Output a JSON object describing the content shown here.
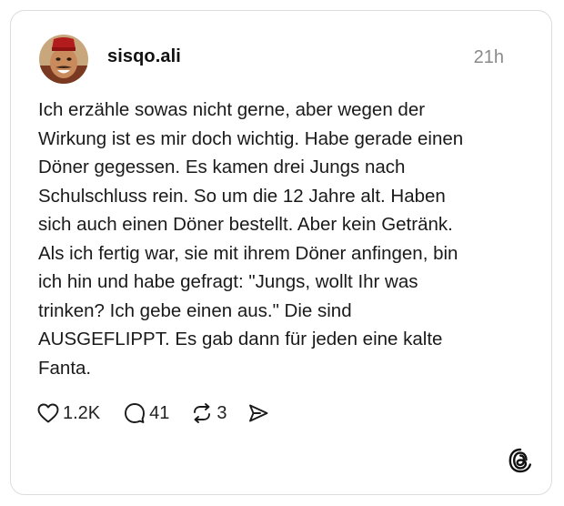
{
  "post": {
    "username": "sisqo.ali",
    "timestamp": "21h",
    "text": "Ich erzähle sowas nicht gerne, aber wegen der\nWirkung ist es mir doch wichtig. Habe gerade einen\nDöner gegessen. Es kamen drei Jungs nach\nSchulschluss rein. So um die 12 Jahre alt. Haben\nsich auch einen Döner bestellt. Aber kein Getränk.\nAls ich fertig war, sie mit ihrem Döner anfingen, bin\nich hin und habe gefragt: \"Jungs, wollt Ihr was\ntrinken? Ich gebe einen aus.\" Die sind\nAUSGEFLIPPT. Es gab dann für jeden eine kalte\nFanta."
  },
  "actions": {
    "likes": "1.2K",
    "replies": "41",
    "reposts": "3"
  },
  "icons": {
    "like": "heart-icon",
    "reply": "speech-bubble-icon",
    "repost": "repost-arrows-icon",
    "share": "paper-plane-icon",
    "logo": "threads-logo-icon"
  },
  "colors": {
    "text": "#1a1a1a",
    "muted": "#8a8a8a",
    "border": "#dcdcdc"
  }
}
